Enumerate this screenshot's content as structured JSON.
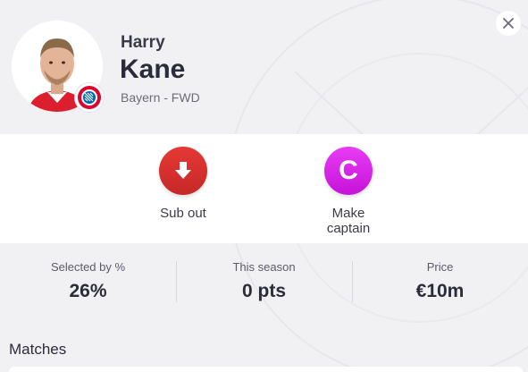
{
  "player": {
    "first_name": "Harry",
    "last_name": "Kane",
    "club_position": "Bayern - FWD"
  },
  "actions": {
    "sub_out_label": "Sub out",
    "make_captain_label": "Make\ncaptain",
    "captain_letter": "C"
  },
  "stats": {
    "selected_label": "Selected by %",
    "selected_value": "26%",
    "season_label": "This season",
    "season_value": "0 pts",
    "price_label": "Price",
    "price_value": "€10m"
  },
  "sections": {
    "matches_title": "Matches"
  },
  "icons": {
    "close": "close-icon",
    "sub_out": "arrow-down-icon",
    "club": "bayern-badge-icon"
  },
  "colors": {
    "sub_out": "#d32f2f",
    "captain": "#d81fe6",
    "background": "#f1f1f4"
  }
}
